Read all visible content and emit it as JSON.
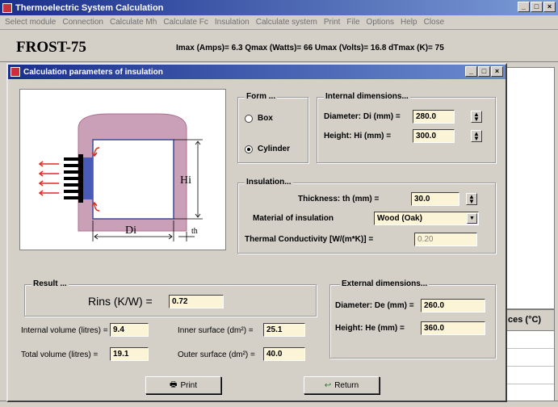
{
  "app": {
    "title": "Thermoelectric System Calculation",
    "model": "FROST-75",
    "params": "Imax (Amps)= 6.3  Qmax (Watts)= 66  Umax  (Volts)= 16.8  dTmax (K)= 75"
  },
  "menu": [
    "Select module",
    "Connection",
    "Calculate Mh",
    "Calculate Fc",
    "Insulation",
    "Calculate system",
    "Print",
    "File",
    "Options",
    "Help",
    "Close"
  ],
  "window_buttons": [
    "_",
    "□",
    "×"
  ],
  "dialog": {
    "title": "Calculation parameters of insulation",
    "diagram": {
      "label_hi": "Hi",
      "label_di": "Di",
      "label_th": "th"
    },
    "form": {
      "label": "Form ...",
      "options": [
        {
          "label": "Box",
          "selected": false
        },
        {
          "label": "Cylinder",
          "selected": true
        }
      ]
    },
    "internal": {
      "label": "Internal dimensions...",
      "diameter_label": "Diameter: Di (mm) =",
      "diameter_value": "280.0",
      "height_label": "Height: Hi (mm) =",
      "height_value": "300.0"
    },
    "insulation": {
      "label": "Insulation...",
      "thickness_label": "Thickness: th (mm) =",
      "thickness_value": "30.0",
      "material_label": "Material of insulation",
      "material_value": "Wood (Oak)",
      "conductivity_label": "Thermal Conductivity  [W/(m*K)]  =",
      "conductivity_value": "0.20"
    },
    "result": {
      "label": "Result ...",
      "rins_label": "Rins (K/W) =",
      "rins_value": "0.72",
      "internal_volume_label": "Internal volume (litres) =",
      "internal_volume_value": "9.4",
      "inner_surface_label": "Inner surface (dm²) =",
      "inner_surface_value": "25.1",
      "total_volume_label": "Total volume (litres) =",
      "total_volume_value": "19.1",
      "outer_surface_label": "Outer surface (dm²) =",
      "outer_surface_value": "40.0"
    },
    "external": {
      "label": "External dimensions...",
      "diameter_label": "Diameter: De (mm) =",
      "diameter_value": "260.0",
      "height_label": "Height: He (mm) =",
      "height_value": "360.0"
    },
    "buttons": {
      "print": "Print",
      "return": "Return"
    }
  },
  "right_table": {
    "header": "ces (°C)"
  },
  "colors": {
    "title_bar": "#1a2f8c",
    "field_bg": "#fcf4d6",
    "insulation_fill": "#c9a0b8",
    "wall": "#e0b8cc"
  }
}
